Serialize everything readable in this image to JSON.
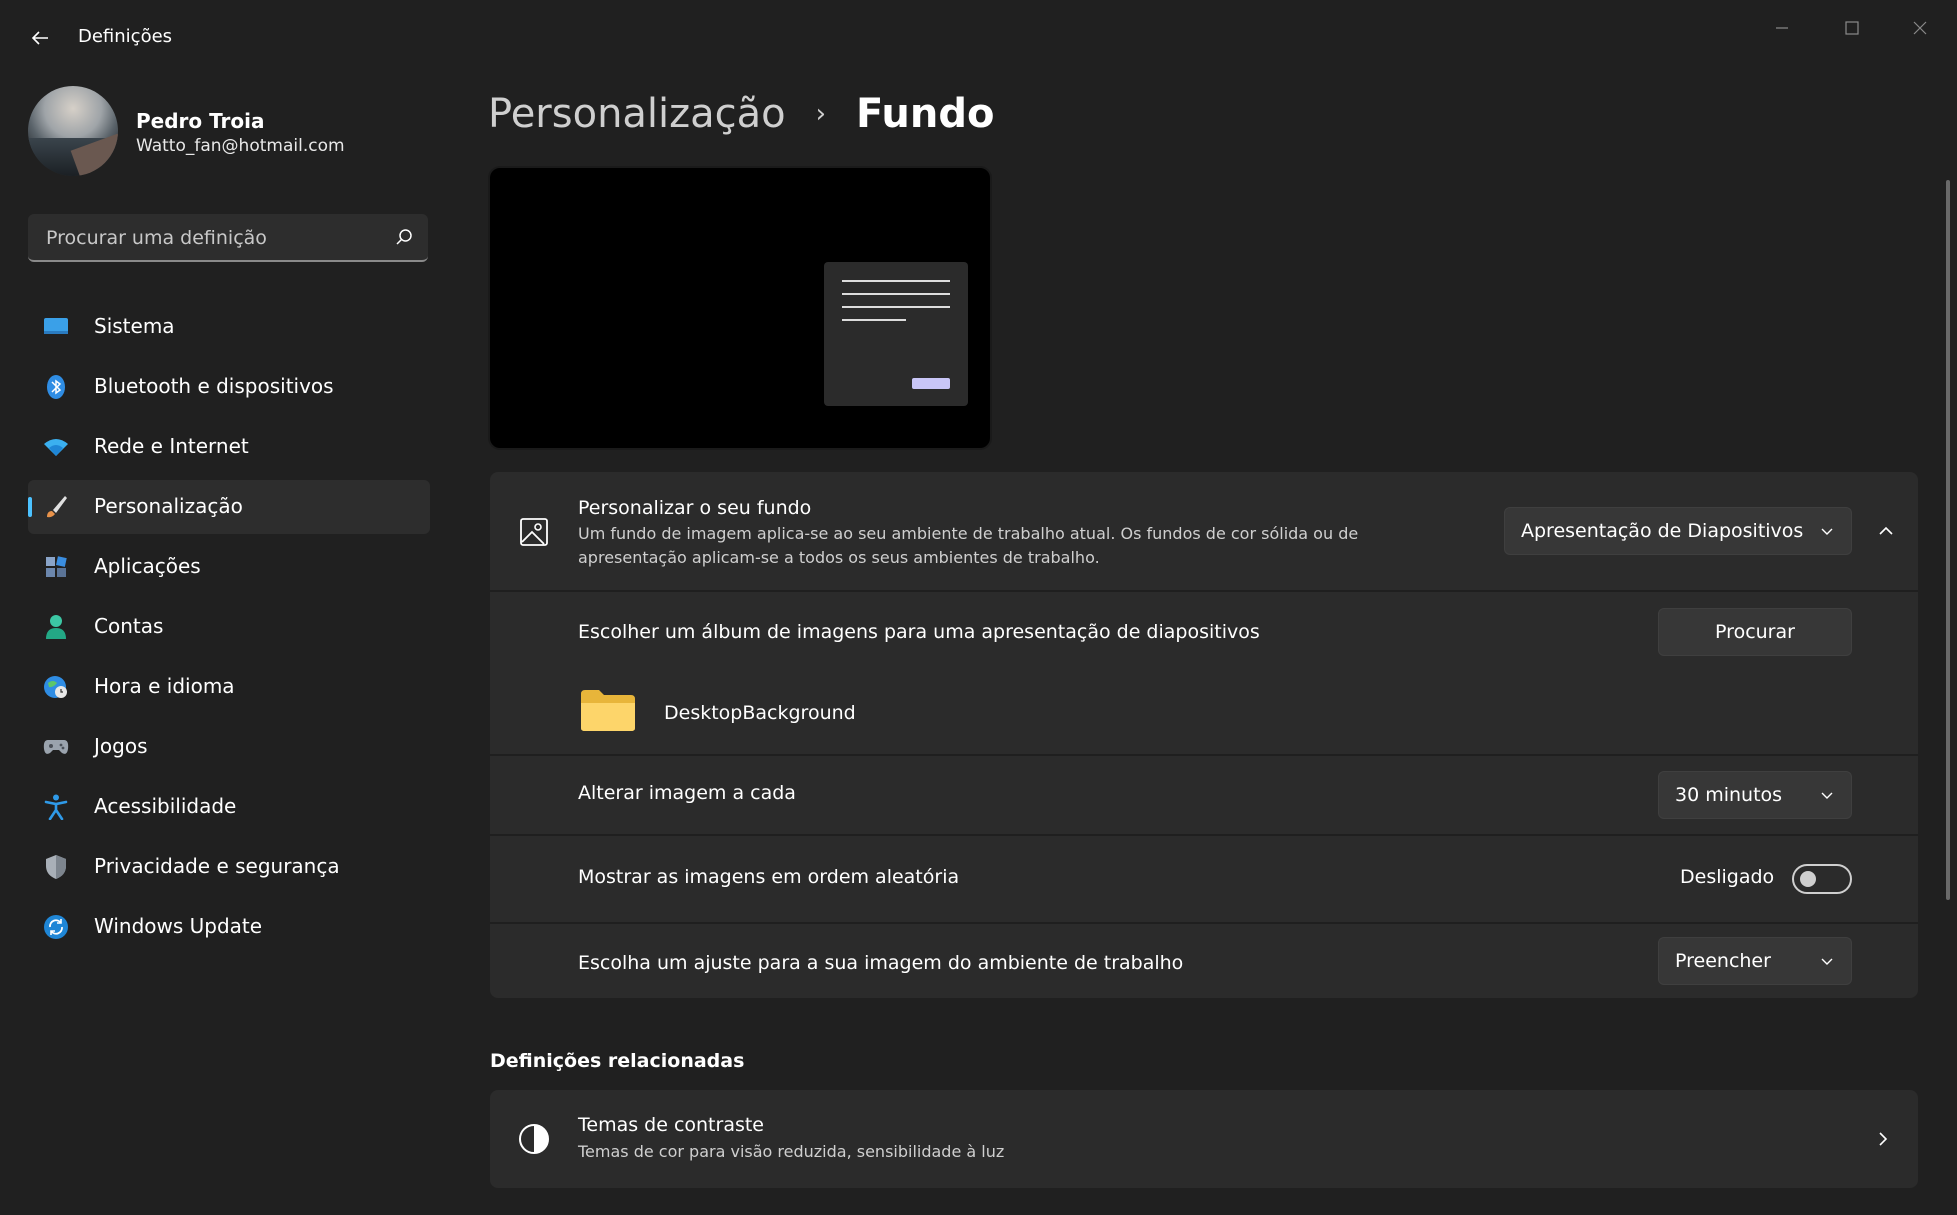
{
  "window": {
    "title": "Definições",
    "controls": {
      "minimize_icon": "minimize-icon",
      "maximize_icon": "maximize-icon",
      "close_icon": "close-icon"
    }
  },
  "profile": {
    "name": "Pedro Troia",
    "email": "Watto_fan@hotmail.com"
  },
  "search": {
    "placeholder": "Procurar uma definição"
  },
  "sidebar": {
    "items": [
      {
        "label": "Sistema",
        "icon": "system-icon",
        "active": false
      },
      {
        "label": "Bluetooth e dispositivos",
        "icon": "bluetooth-icon",
        "active": false
      },
      {
        "label": "Rede e Internet",
        "icon": "wifi-icon",
        "active": false
      },
      {
        "label": "Personalização",
        "icon": "brush-icon",
        "active": true
      },
      {
        "label": "Aplicações",
        "icon": "apps-icon",
        "active": false
      },
      {
        "label": "Contas",
        "icon": "person-icon",
        "active": false
      },
      {
        "label": "Hora e idioma",
        "icon": "globe-clock-icon",
        "active": false
      },
      {
        "label": "Jogos",
        "icon": "gamepad-icon",
        "active": false
      },
      {
        "label": "Acessibilidade",
        "icon": "accessibility-icon",
        "active": false
      },
      {
        "label": "Privacidade e segurança",
        "icon": "shield-icon",
        "active": false
      },
      {
        "label": "Windows Update",
        "icon": "update-icon",
        "active": false
      }
    ],
    "accent_color": "#4cc2ff"
  },
  "breadcrumb": {
    "parent": "Personalização",
    "separator": "›",
    "current": "Fundo"
  },
  "background_panel": {
    "title": "Personalizar o seu fundo",
    "description_line1": "Um fundo de imagem aplica-se ao seu ambiente de trabalho atual. Os fundos de cor sólida ou de",
    "description_line2": "apresentação aplicam-se a todos os seus ambientes de trabalho.",
    "type_value": "Apresentação de Diapositivos",
    "album_label": "Escolher um álbum de imagens para uma apresentação de diapositivos",
    "browse_label": "Procurar",
    "folder_name": "DesktopBackground",
    "interval_label": "Alterar imagem a cada",
    "interval_value": "30 minutos",
    "shuffle_label": "Mostrar as imagens em ordem aleatória",
    "shuffle_state": "Desligado",
    "fit_label": "Escolha um ajuste para a sua imagem do ambiente de trabalho",
    "fit_value": "Preencher"
  },
  "related": {
    "heading": "Definições relacionadas",
    "contrast_title": "Temas de contraste",
    "contrast_desc": "Temas de cor para visão reduzida, sensibilidade à luz"
  }
}
